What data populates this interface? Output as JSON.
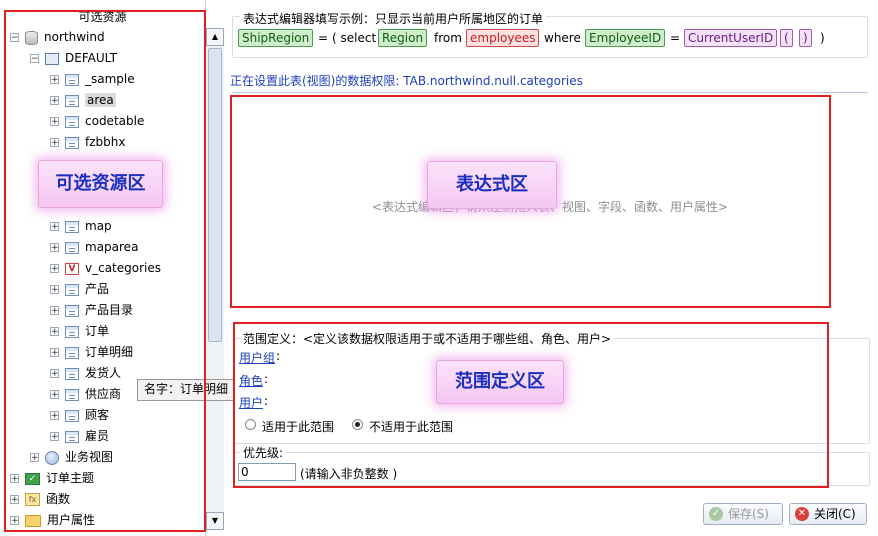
{
  "left_panel": {
    "title": "可选资源",
    "tree": {
      "root": "northwind",
      "schema": "DEFAULT",
      "tables": [
        "_sample",
        "area",
        "codetable",
        "fzbbhx",
        "map",
        "maparea",
        "v_categories",
        "产品",
        "产品目录",
        "订单",
        "订单明细",
        "发货人",
        "供应商",
        "顾客",
        "雇员"
      ],
      "business_view": "业务视图",
      "order_subject": "订单主题",
      "functions": "函数",
      "user_attributes": "用户属性"
    },
    "tooltip": "名字：订单明细"
  },
  "callouts": {
    "resource_area": "可选资源区",
    "expression_area": "表达式区",
    "scope_area": "范围定义区"
  },
  "example": {
    "legend": "表达式编辑器填写示例：只显示当前用户所属地区的订单",
    "tokens": {
      "ship_region": "ShipRegion",
      "eq1": "=",
      "paren_select": "( select",
      "region": "Region",
      "from": "from",
      "employees": "employees",
      "where": "where",
      "employee_id": "EmployeeID",
      "eq2": "=",
      "current_user_id": "CurrentUserID",
      "open_paren": "(",
      "close_paren": ")",
      "end_paren": ")"
    }
  },
  "permission_line": "正在设置此表(视图)的数据权限: TAB.northwind.null.categories",
  "expression_placeholder": "<表达式编辑区，请从左侧拖入表、视图、字段、函数、用户属性>",
  "scope": {
    "legend": "范围定义：<定义该数据权限适用于或不适用于哪些组、角色、用户>",
    "user_group": "用户组",
    "role": "角色",
    "user": "用户",
    "colon": ":",
    "apply_option": "适用于此范围",
    "not_apply_option": "不适用于此范围",
    "selected": "not_apply"
  },
  "priority": {
    "legend": "优先级:",
    "value": "0",
    "hint": "(请输入非负整数 )"
  },
  "buttons": {
    "save": "保存(S)",
    "close": "关闭(C)"
  }
}
